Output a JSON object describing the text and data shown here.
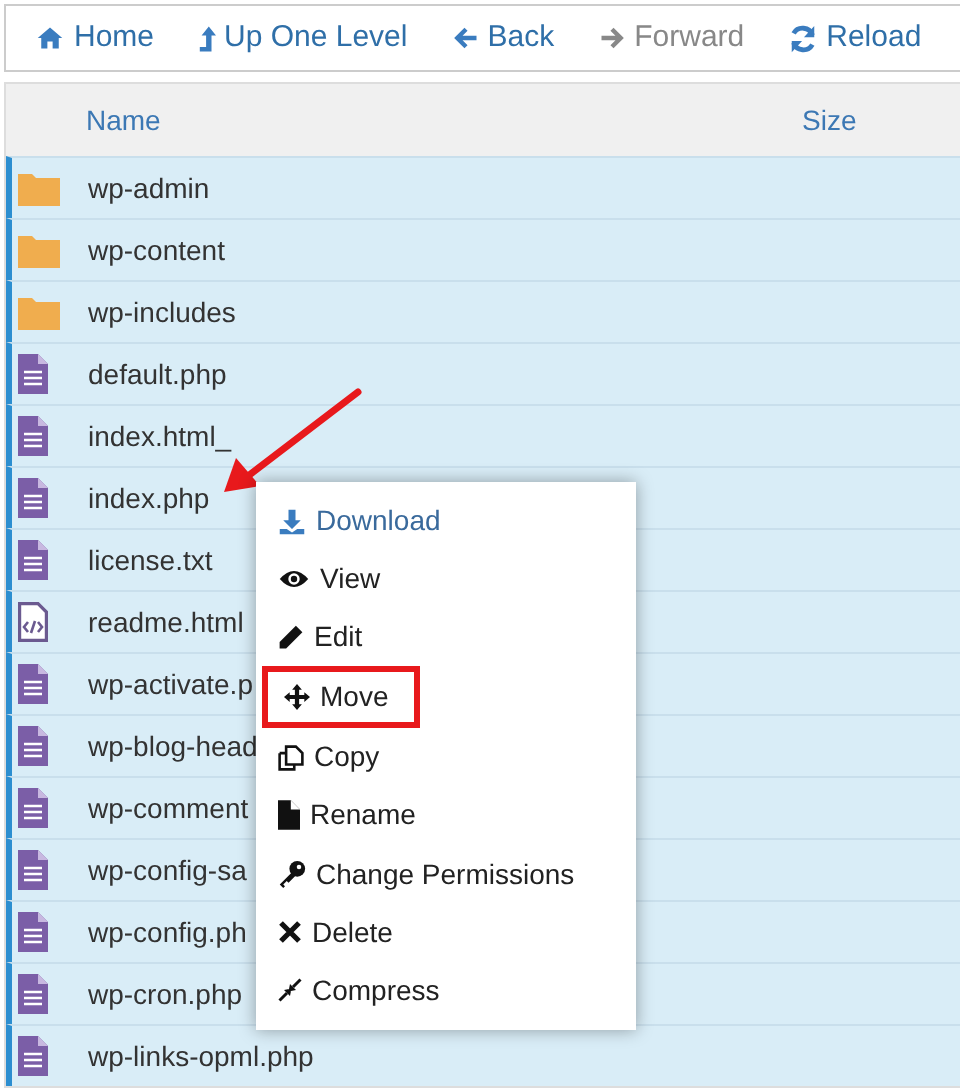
{
  "toolbar": [
    {
      "label": "Home",
      "disabled": false
    },
    {
      "label": "Up One Level",
      "disabled": false
    },
    {
      "label": "Back",
      "disabled": false
    },
    {
      "label": "Forward",
      "disabled": true
    },
    {
      "label": "Reload",
      "disabled": false
    }
  ],
  "table": {
    "columns": [
      "Name",
      "Size"
    ],
    "rows": [
      {
        "name": "wp-admin",
        "kind": "folder",
        "selected": true
      },
      {
        "name": "wp-content",
        "kind": "folder",
        "selected": true
      },
      {
        "name": "wp-includes",
        "kind": "folder",
        "selected": true
      },
      {
        "name": "default.php",
        "kind": "text",
        "selected": true
      },
      {
        "name": "index.html_",
        "kind": "text",
        "selected": true
      },
      {
        "name": "index.php",
        "kind": "text",
        "selected": true
      },
      {
        "name": "license.txt",
        "kind": "text",
        "selected": true
      },
      {
        "name": "readme.html",
        "kind": "code",
        "selected": true
      },
      {
        "name": "wp-activate.p",
        "kind": "text",
        "selected": true
      },
      {
        "name": "wp-blog-head",
        "kind": "text",
        "selected": true
      },
      {
        "name": "wp-comment",
        "kind": "text",
        "selected": true
      },
      {
        "name": "wp-config-sa",
        "kind": "text",
        "selected": true
      },
      {
        "name": "wp-config.ph",
        "kind": "text",
        "selected": true
      },
      {
        "name": "wp-cron.php",
        "kind": "text",
        "selected": true
      },
      {
        "name": "wp-links-opml.php",
        "kind": "text",
        "selected": true
      }
    ]
  },
  "context_menu": {
    "items": [
      {
        "label": "Download",
        "highlighted": false,
        "hovered": true
      },
      {
        "label": "View",
        "highlighted": false,
        "hovered": false
      },
      {
        "label": "Edit",
        "highlighted": false,
        "hovered": false
      },
      {
        "label": "Move",
        "highlighted": true,
        "hovered": false
      },
      {
        "label": "Copy",
        "highlighted": false,
        "hovered": false
      },
      {
        "label": "Rename",
        "highlighted": false,
        "hovered": false
      },
      {
        "label": "Change Permissions",
        "highlighted": false,
        "hovered": false
      },
      {
        "label": "Delete",
        "highlighted": false,
        "hovered": false
      },
      {
        "label": "Compress",
        "highlighted": false,
        "hovered": false
      }
    ]
  }
}
